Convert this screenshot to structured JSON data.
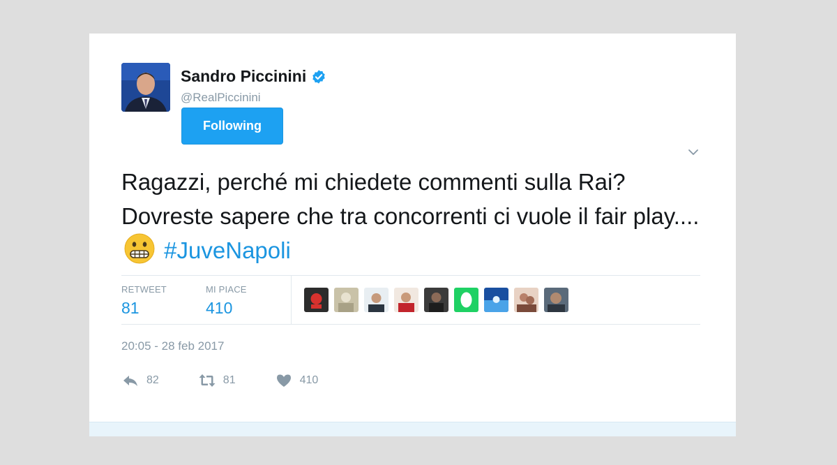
{
  "author": {
    "name": "Sandro Piccinini",
    "handle": "@RealPiccinini",
    "follow_label": "Following"
  },
  "tweet": {
    "text_before": "Ragazzi, perché mi chiedete commenti sulla Rai? Dovreste sapere che tra concorrenti ci vuole il fair play....",
    "hashtag": "#JuveNapoli",
    "emoji": "grimacing-face-emoji"
  },
  "stats": {
    "retweet_label": "RETWEET",
    "retweet_count": "81",
    "likes_label": "MI PIACE",
    "likes_count": "410",
    "liker_avatar_count": 9
  },
  "timestamp": "20:05 - 28 feb 2017",
  "actions": {
    "reply_count": "82",
    "retweet_count": "81",
    "like_count": "410"
  },
  "colors": {
    "accent": "#1da1f2",
    "link": "#1b95e0",
    "muted": "#8899a6",
    "text": "#14171a"
  }
}
